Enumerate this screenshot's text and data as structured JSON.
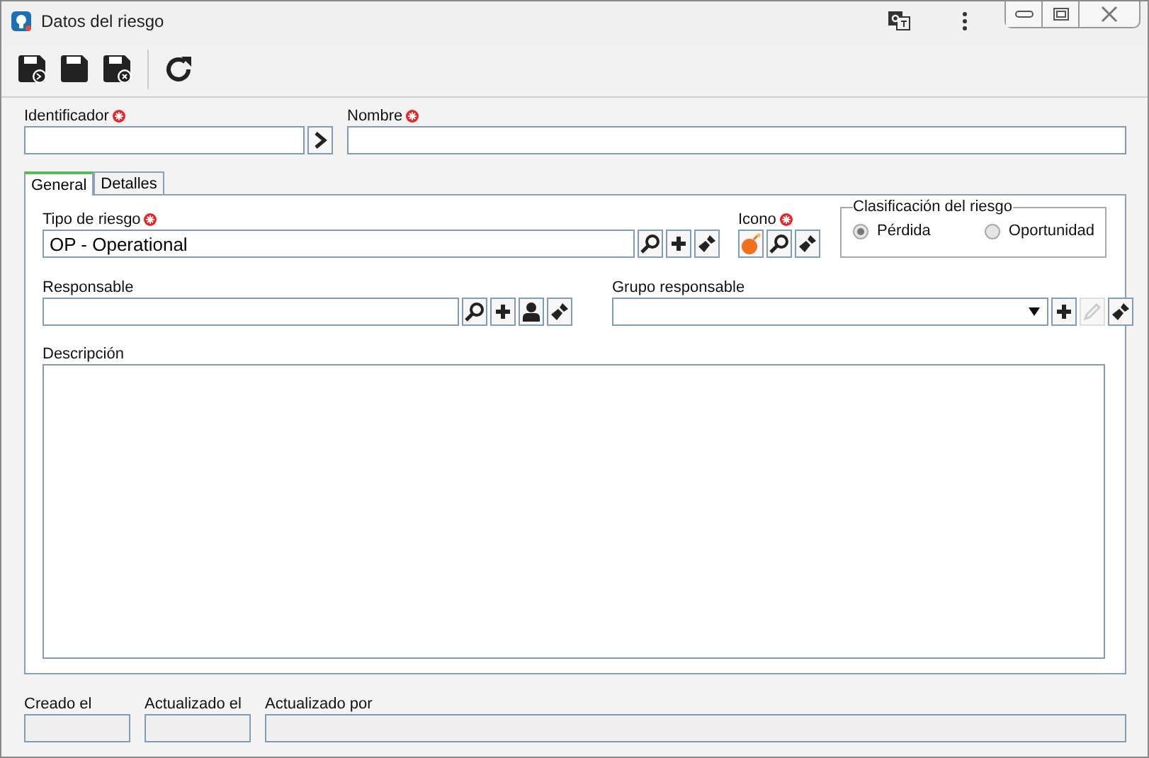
{
  "window": {
    "title": "Datos del riesgo"
  },
  "header": {
    "identifier": {
      "label": "Identificador",
      "required": true
    },
    "name": {
      "label": "Nombre",
      "required": true
    }
  },
  "tabs": [
    {
      "label": "General",
      "selected": true
    },
    {
      "label": "Detalles",
      "selected": false
    }
  ],
  "risk_type": {
    "label": "Tipo de riesgo",
    "required": true,
    "value": "OP - Operational"
  },
  "icon_field": {
    "label": "Icono",
    "required": true
  },
  "classification": {
    "legend": "Clasificación del riesgo",
    "options": [
      {
        "label": "Pérdida",
        "selected": true
      },
      {
        "label": "Oportunidad",
        "selected": false
      }
    ]
  },
  "responsible": {
    "label": "Responsable"
  },
  "responsible_group": {
    "label": "Grupo responsable",
    "edit_disabled": true
  },
  "description": {
    "label": "Descripción"
  },
  "footer": [
    {
      "label": "Creado el"
    },
    {
      "label": "Actualizado el"
    },
    {
      "label": "Actualizado por"
    }
  ]
}
